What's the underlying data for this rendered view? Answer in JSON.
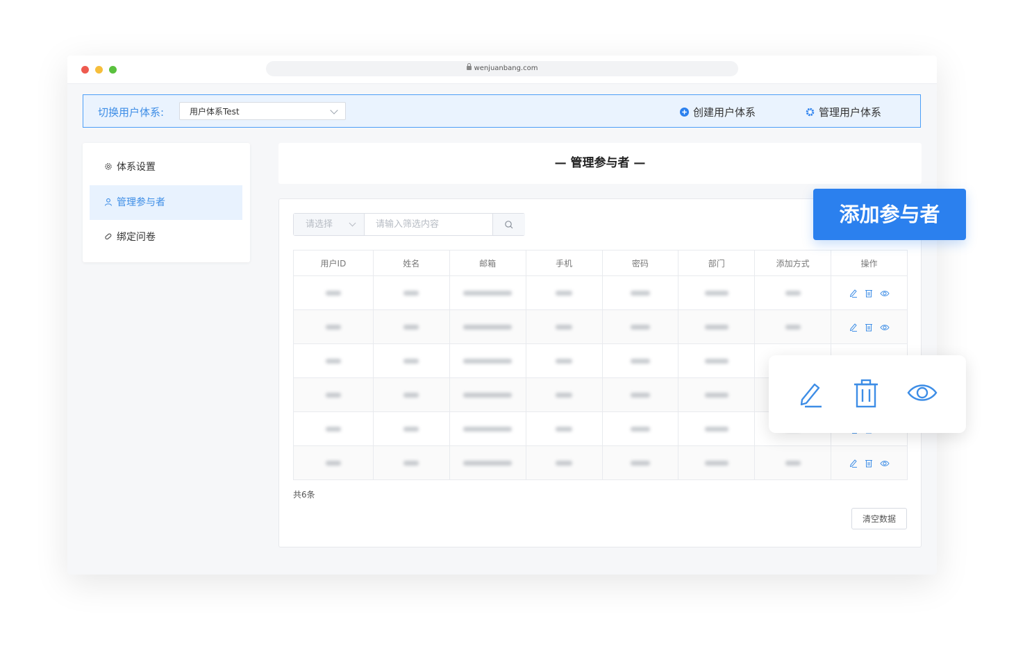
{
  "browser": {
    "url": "wenjuanbang.com"
  },
  "topbar": {
    "switch_label": "切换用户体系:",
    "selected_system": "用户体系Test",
    "create_label": "创建用户体系",
    "manage_label": "管理用户体系"
  },
  "sidebar": {
    "items": [
      {
        "label": "体系设置",
        "icon": "gear-icon"
      },
      {
        "label": "管理参与者",
        "icon": "user-icon"
      },
      {
        "label": "绑定问卷",
        "icon": "paperclip-icon"
      }
    ]
  },
  "main": {
    "title": "— 管理参与者 —",
    "filter": {
      "select_placeholder": "请选择",
      "input_placeholder": "请输入筛选内容"
    },
    "table": {
      "columns": [
        "用户ID",
        "姓名",
        "邮箱",
        "手机",
        "密码",
        "部门",
        "添加方式",
        "操作"
      ]
    },
    "total": "共6条",
    "clear_label": "清空数据"
  },
  "callout": {
    "add_label": "添加参与者"
  },
  "colors": {
    "accent": "#2b80ee",
    "accent_light": "#eaf3fe",
    "active_text": "#3d8de6"
  }
}
